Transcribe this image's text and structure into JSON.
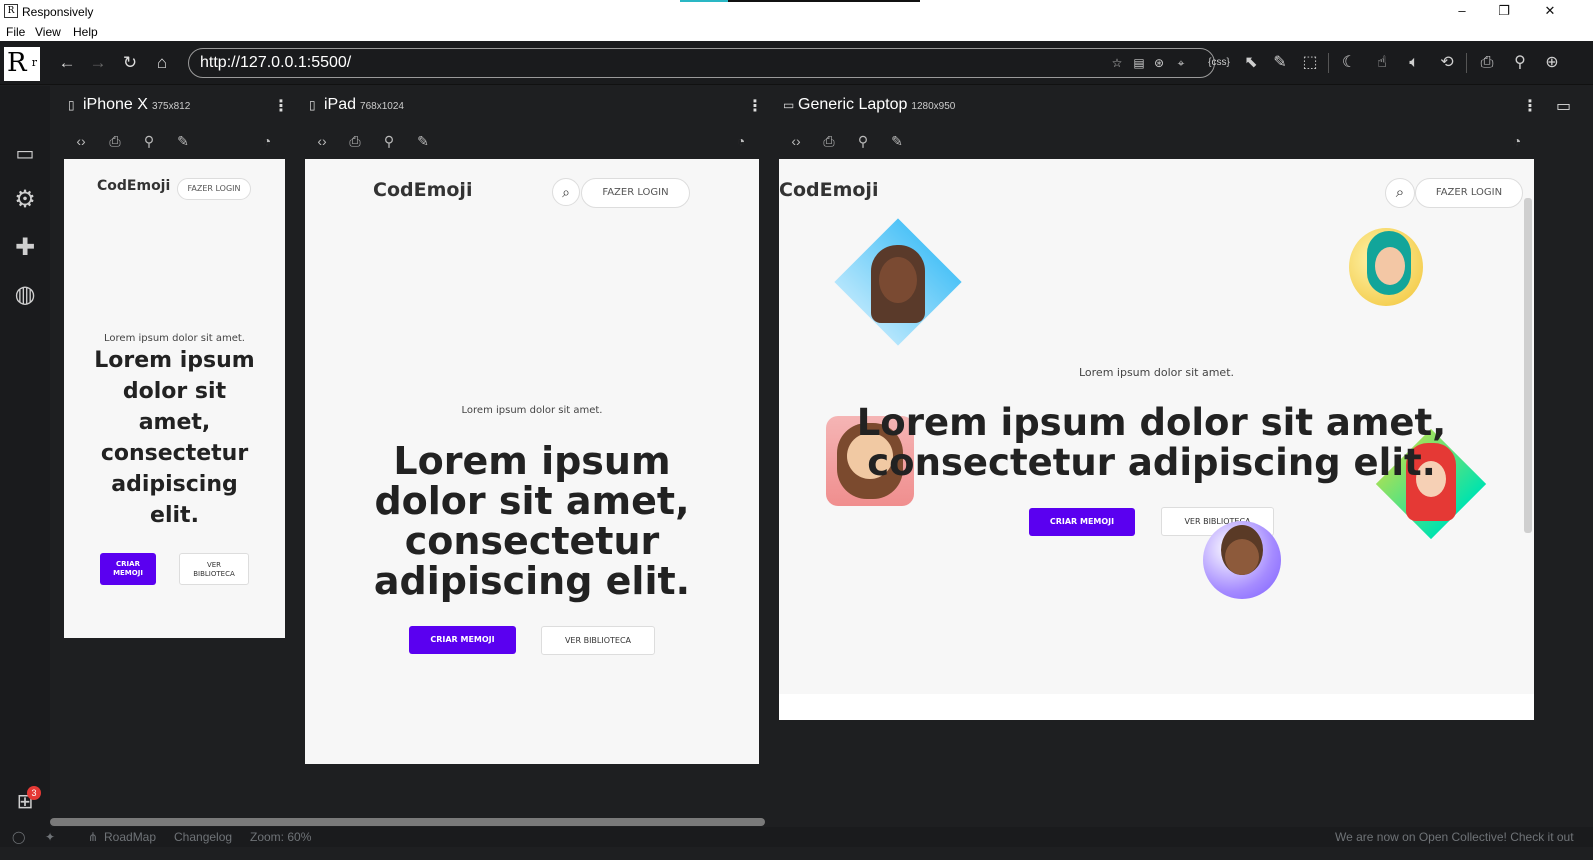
{
  "window": {
    "title": "Responsively"
  },
  "menu": {
    "items": [
      "File",
      "View",
      "Help"
    ]
  },
  "toolbar": {
    "url": "http://127.0.0.1:5500/",
    "logo_text": "R",
    "logo_sub": "r"
  },
  "devices": [
    {
      "name": "iPhone X",
      "size": "375x812"
    },
    {
      "name": "iPad",
      "size": "768x1024"
    },
    {
      "name": "Generic Laptop",
      "size": "1280x950"
    }
  ],
  "site": {
    "brand": "CodEmoji",
    "login": "FAZER LOGIN",
    "kicker": "Lorem ipsum dolor sit amet.",
    "headline": "Lorem ipsum dolor sit amet, consectetur adipiscing elit.",
    "primary_cta": "CRIAR MEMOJI",
    "secondary_cta": "VER BIBLIOTECA",
    "phone_primary": "CRIAR\nMEMOJI",
    "phone_secondary": "VER\nBIBLIOTECA"
  },
  "sidebar": {
    "gift_badge": "3"
  },
  "statusbar": {
    "roadmap": "RoadMap",
    "changelog": "Changelog",
    "zoom": "Zoom: 60%",
    "message": "We are now on Open Collective! Check it out"
  },
  "colors": {
    "accent": "#5a00f0",
    "chrome": "#1a1b1d",
    "page_bg": "#f7f7f7"
  },
  "icons": [
    "back-icon",
    "forward-icon",
    "reload-icon",
    "home-icon",
    "star-icon",
    "css-icon",
    "pointer-icon",
    "edit-icon",
    "moon-icon",
    "touch-icon",
    "speaker-icon",
    "rotate-icon",
    "screenshot-icon",
    "zoom-icon",
    "devices-icon",
    "gear-icon",
    "puzzle-icon",
    "globe-icon",
    "gift-icon",
    "github-icon",
    "twitter-icon"
  ]
}
